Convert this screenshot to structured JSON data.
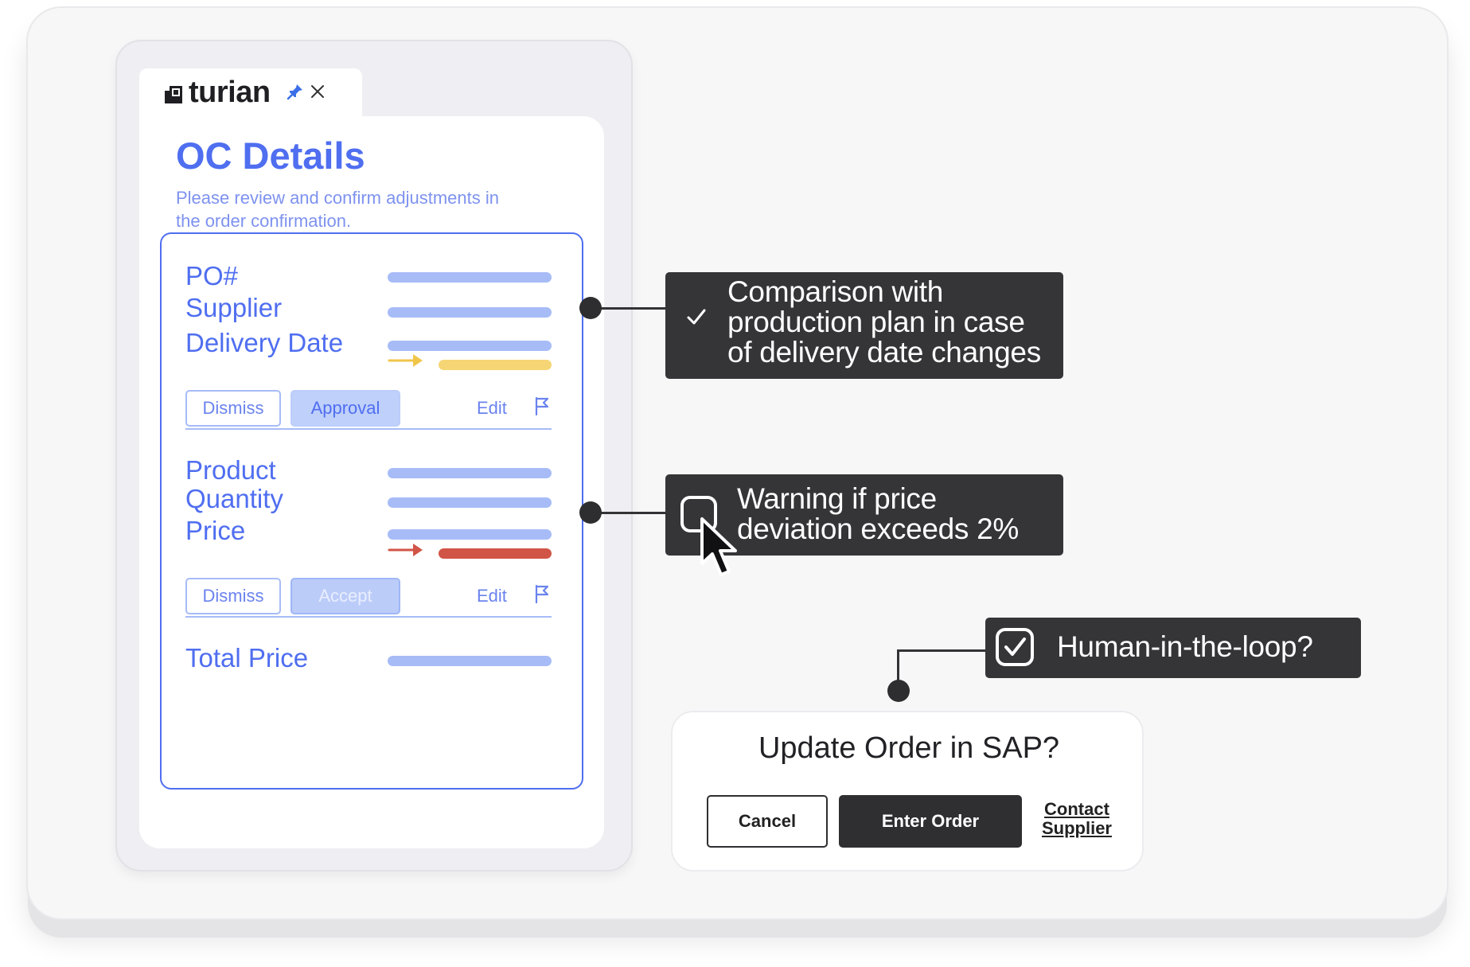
{
  "extension": {
    "brand": "turian",
    "title": "OC Details",
    "subtitle": "Please review and confirm adjustments in the order confirmation.",
    "section1": {
      "fields": [
        "PO#",
        "Supplier",
        "Delivery Date"
      ],
      "dismiss_label": "Dismiss",
      "approve_label": "Approval",
      "edit_label": "Edit"
    },
    "section2": {
      "fields": [
        "Product",
        "Quantity",
        "Price"
      ],
      "dismiss_label": "Dismiss",
      "accept_label": "Accept",
      "edit_label": "Edit"
    },
    "total_label": "Total Price"
  },
  "callouts": {
    "comparison": {
      "line1": "Comparison with",
      "line2": "production plan in case",
      "line3": "of delivery date changes"
    },
    "warning": {
      "line1": "Warning if price",
      "line2": "deviation exceeds 2%"
    },
    "human": {
      "label": "Human-in-the-loop?"
    }
  },
  "sap_dialog": {
    "title": "Update Order in SAP?",
    "cancel_label": "Cancel",
    "enter_label": "Enter Order",
    "contact_line1": "Contact",
    "contact_line2": "Supplier"
  },
  "colors": {
    "accent_blue": "#4f6ef0",
    "light_blue": "#a7bcf7",
    "yellow": "#f6d574",
    "red": "#d15546",
    "dark": "#353538"
  },
  "icons": [
    "turian-logo-icon",
    "pin-icon",
    "close-icon",
    "flag-icon",
    "checkmark-icon",
    "checkbox-icon",
    "cursor-icon",
    "arrow-right-icon"
  ]
}
